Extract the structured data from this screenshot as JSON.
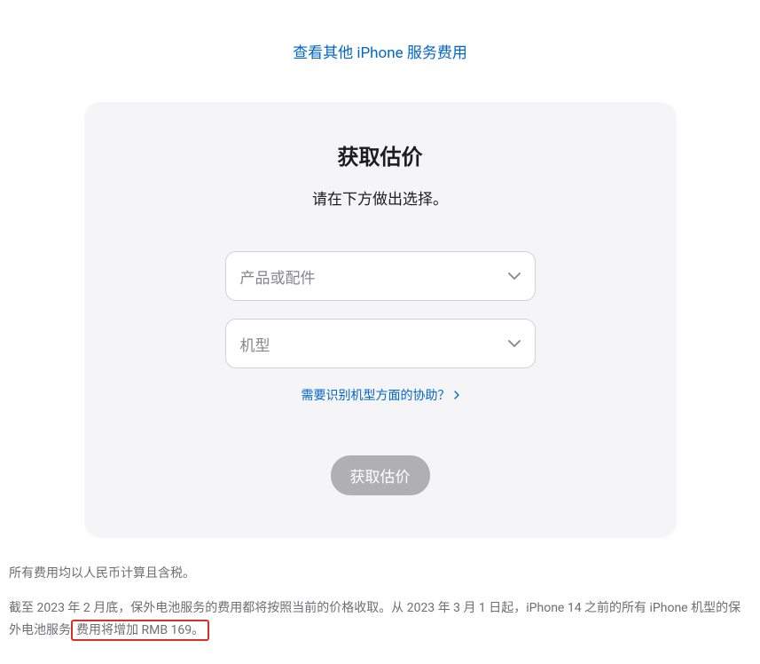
{
  "header": {
    "top_link": "查看其他 iPhone 服务费用"
  },
  "card": {
    "title": "获取估价",
    "subtitle": "请在下方做出选择。",
    "select1_placeholder": "产品或配件",
    "select2_placeholder": "机型",
    "help_link": "需要识别机型方面的协助？",
    "submit_label": "获取估价"
  },
  "footer": {
    "line1": "所有费用均以人民币计算且含税。",
    "line2_part1": "截至 2023 年 2 月底，保外电池服务的费用都将按照当前的价格收取。从 2023 年 3 月 1 日起，iPhone 14 之前的所有 iPhone 机型的保外电池服务",
    "line2_highlighted": "费用将增加 RMB 169。"
  }
}
